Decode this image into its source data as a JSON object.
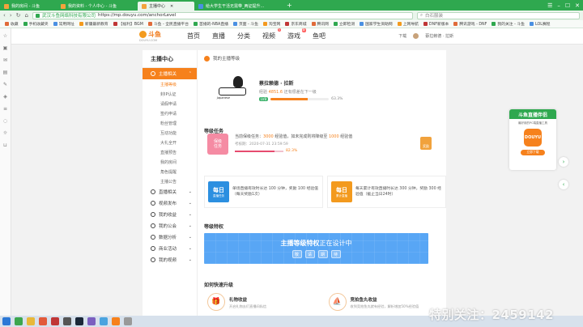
{
  "browser": {
    "tabs": [
      {
        "label": "我的房间 - 斗鱼",
        "active": false
      },
      {
        "label": "我的资料 - 个人中心 - 斗鱼",
        "active": false
      },
      {
        "label": "主播中心",
        "active": true
      },
      {
        "label": "给大学生干活无需带_两证提升...",
        "active": false
      }
    ],
    "url_site": "武汉斗鱼网络科技有限公司",
    "url": "https://mp.douyu.com/anchorLevel",
    "search_text": "白石服装",
    "bookmarks": [
      "收藏",
      "手机收藏夹",
      "常用网址",
      "新疆最新教育",
      "【福利】BGM",
      "斗鱼 - 全民直播平台",
      "首播的-NBA直播",
      "页面 - 斗鱼",
      "淘宝网",
      "京东商城",
      "腾讯网",
      "立即检测",
      "国家学生资助网",
      "上网导航",
      "DNF新版本",
      "腾讯游戏 - DNF",
      "我的关注 - 斗鱼",
      "LOL赛程"
    ]
  },
  "site": {
    "logo_text": "斗鱼",
    "logo_sub": "DOUYU.COM",
    "nav": [
      {
        "label": "首页"
      },
      {
        "label": "直播"
      },
      {
        "label": "分类"
      },
      {
        "label": "视频",
        "badge": "5"
      },
      {
        "label": "游戏",
        "badge": "新"
      },
      {
        "label": "鱼吧"
      }
    ],
    "download_label": "下载",
    "user_label": "蔡拉赖德 · 拉斯"
  },
  "sidebar": {
    "title": "主播中心",
    "groups": [
      {
        "label": "主播相关",
        "active": true,
        "children": [
          "主播等级",
          "封IP认证",
          "请假申请",
          "签约申请",
          "粉丝管理",
          "互动功能",
          "大礼全开",
          "直播预告",
          "我的房间",
          "角色提醒",
          "主播公告"
        ]
      },
      {
        "label": "直播相关",
        "children": []
      },
      {
        "label": "视频发布",
        "children": []
      },
      {
        "label": "我的收益",
        "children": []
      },
      {
        "label": "我的公会",
        "children": []
      },
      {
        "label": "数据分析",
        "children": []
      },
      {
        "label": "商业活动",
        "children": []
      },
      {
        "label": "我的视频",
        "children": []
      }
    ]
  },
  "main": {
    "breadcrumb": "我的主播等级",
    "level": {
      "name": "蔡拉赖德 · 拉斯",
      "exp_label": "经验",
      "exp_value": "4851.6",
      "exp_suffix": "还有很差在下一级",
      "current_level": "LV8",
      "progress_text": "63.3%",
      "progress": 0.633,
      "logo_caption": "Japanese"
    },
    "tasks_title": "等级任务",
    "task": {
      "icon_line1": "保级",
      "icon_line2": "任务",
      "desc_prefix": "当前保级任务：",
      "desc_em1": "3000",
      "desc_mid": " 经验值，如未完成则将降级至 ",
      "desc_em2": "1000",
      "desc_suffix": " 经验值",
      "time": "考核期：2020-07-31 23:59:59",
      "progress_text": "82.3%",
      "progress": 0.823,
      "right_badge": "奖励"
    },
    "daily": [
      {
        "big": "每日",
        "small": "直播任务",
        "color": "blue",
        "text": "单场直播有效时长达 100 分钟，奖励 100 经验值（每天奖励1次）"
      },
      {
        "big": "每日",
        "small": "累计直播",
        "color": "orange",
        "text": "每天累计有效直播时长达 300 分钟，奖励 300 经验值（截止当日24时）"
      }
    ],
    "privilege_title": "等级特权",
    "privilege_banner_bold": "主播等级特权",
    "privilege_banner_rest": "正在设计中",
    "privilege_keys": [
      "敬",
      "请",
      "期",
      "待"
    ],
    "upgrade_title": "如何快速升级",
    "upgrade": [
      {
        "name": "礼物收益",
        "desc": "开启礼物去们直播间私信",
        "icon": "🎁"
      },
      {
        "name": "竞拍鱼丸收益",
        "desc": "收到竞拍鱼丸就有经验，解析增加50%经验值",
        "icon": "⛵"
      }
    ]
  },
  "float_ad": {
    "title": "斗鱼直播伴侣",
    "subtitle": "最好用的PC端直播工具",
    "app_label": "DOUYU",
    "button": "立即下载"
  },
  "watermark": "特别关注：2459142",
  "colors": {
    "brand_orange": "#f6811c",
    "browser_green": "#2fa84f",
    "banner_blue": "#58a6f5"
  }
}
